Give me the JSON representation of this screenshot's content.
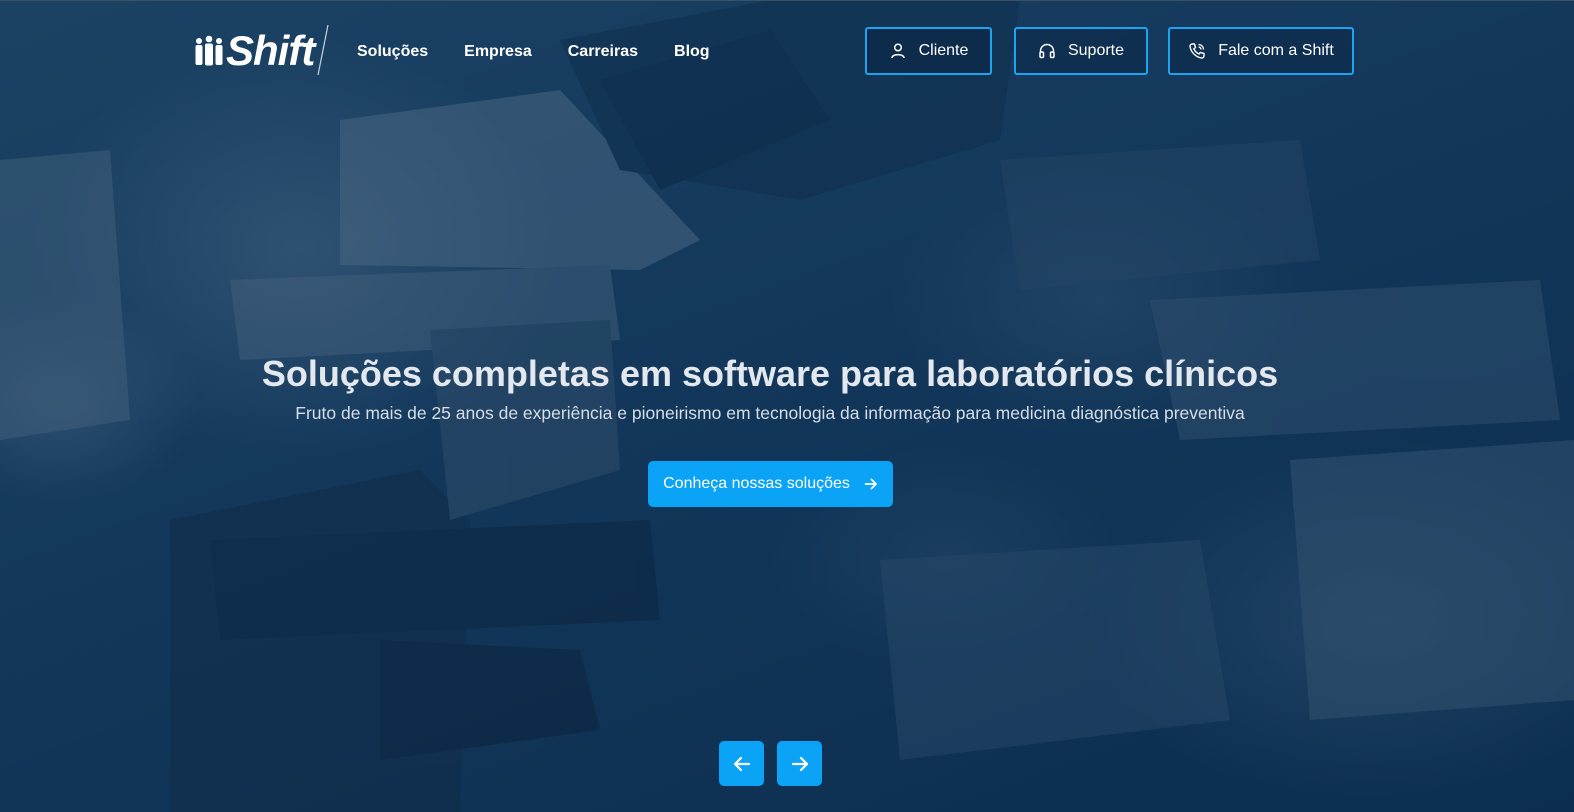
{
  "brand": {
    "name": "Shift",
    "accent_color": "#0aa3f5",
    "border_color": "#1da3f0"
  },
  "nav": {
    "items": [
      "Soluções",
      "Empresa",
      "Carreiras",
      "Blog"
    ]
  },
  "header_buttons": {
    "cliente": {
      "label": "Cliente",
      "icon": "user-icon"
    },
    "suporte": {
      "label": "Suporte",
      "icon": "headphones-icon"
    },
    "fale": {
      "label": "Fale com a Shift",
      "icon": "phone-icon"
    }
  },
  "hero": {
    "title": "Soluções completas em software para laboratórios clínicos",
    "subtitle": "Fruto de mais de 25 anos de experiência e pioneirismo em tecnologia da informação para medicina diagnóstica preventiva",
    "cta_label": "Conheça nossas soluções",
    "cta_icon": "arrow-right-icon",
    "background": "microscope-photo"
  },
  "carousel": {
    "prev_icon": "arrow-left-icon",
    "next_icon": "arrow-right-icon"
  }
}
